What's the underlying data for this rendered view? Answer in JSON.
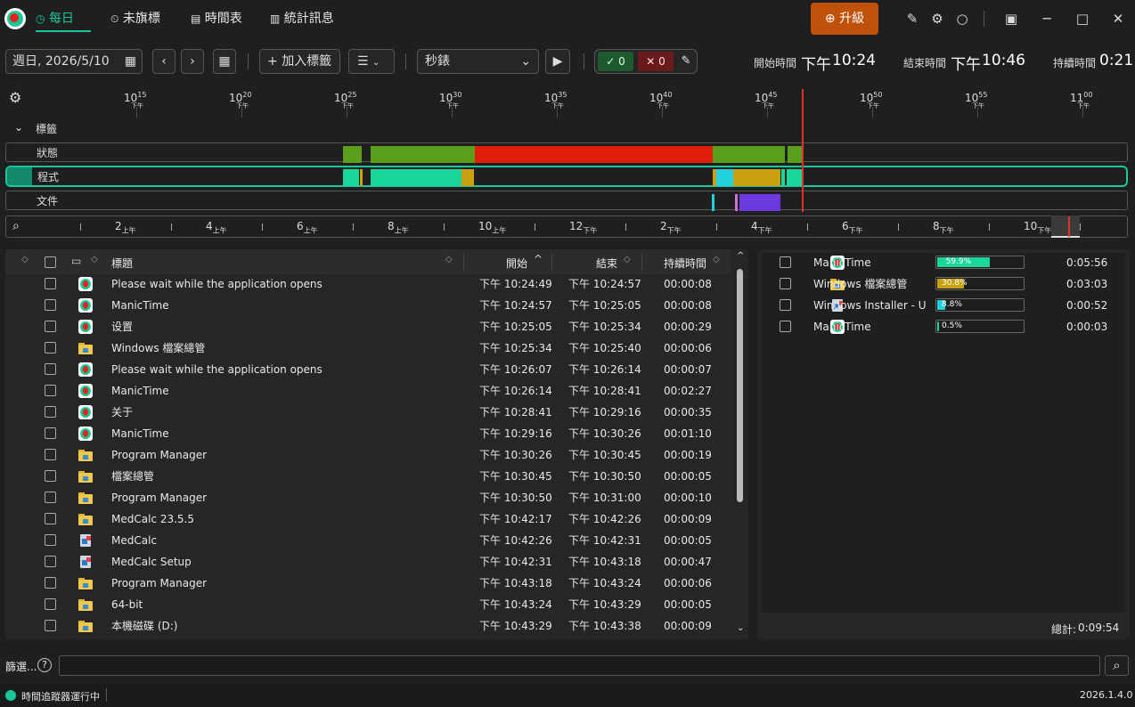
{
  "nav": {
    "tabs": [
      {
        "label": "每日"
      },
      {
        "label": "未旗標"
      },
      {
        "label": "時間表"
      },
      {
        "label": "統計訊息"
      }
    ],
    "upgrade_label": "升級"
  },
  "toolbar": {
    "date": "週日, 2026/5/10",
    "add_tag": "加入標籤",
    "mode": "秒錶",
    "check_count": "0",
    "x_count": "0",
    "start_label": "開始時間",
    "start_ampm": "下午",
    "start_time": "10:24",
    "end_label": "結束時間",
    "end_ampm": "下午",
    "end_time": "10:46",
    "dur_label": "持續時間",
    "dur_value": "0:21"
  },
  "timeline": {
    "ticks": [
      {
        "h": "10",
        "m": "15",
        "ap": "下午"
      },
      {
        "h": "10",
        "m": "20",
        "ap": "下午"
      },
      {
        "h": "10",
        "m": "25",
        "ap": "下午"
      },
      {
        "h": "10",
        "m": "30",
        "ap": "下午"
      },
      {
        "h": "10",
        "m": "35",
        "ap": "下午"
      },
      {
        "h": "10",
        "m": "40",
        "ap": "下午"
      },
      {
        "h": "10",
        "m": "45",
        "ap": "下午"
      },
      {
        "h": "10",
        "m": "50",
        "ap": "下午"
      },
      {
        "h": "10",
        "m": "55",
        "ap": "下午"
      },
      {
        "h": "11",
        "m": "00",
        "ap": "下午"
      }
    ],
    "rows": {
      "tags": "標籤",
      "status": "狀態",
      "apps": "程式",
      "docs": "文件"
    },
    "overview_ticks": [
      {
        "h": "2",
        "ap": "上午"
      },
      {
        "h": "4",
        "ap": "上午"
      },
      {
        "h": "6",
        "ap": "上午"
      },
      {
        "h": "8",
        "ap": "上午"
      },
      {
        "h": "10",
        "ap": "上午"
      },
      {
        "h": "12",
        "ap": "下午"
      },
      {
        "h": "2",
        "ap": "下午"
      },
      {
        "h": "4",
        "ap": "下午"
      },
      {
        "h": "6",
        "ap": "下午"
      },
      {
        "h": "8",
        "ap": "下午"
      },
      {
        "h": "10",
        "ap": "下午"
      }
    ]
  },
  "grid": {
    "headers": {
      "title": "標題",
      "start": "開始",
      "end": "結束",
      "duration": "持續時間"
    },
    "rows": [
      {
        "icon": "manictime",
        "title": "Please wait while the application opens",
        "start": "下午 10:24:49",
        "end": "下午 10:24:57",
        "dur": "00:00:08"
      },
      {
        "icon": "manictime",
        "title": "ManicTime",
        "start": "下午 10:24:57",
        "end": "下午 10:25:05",
        "dur": "00:00:08"
      },
      {
        "icon": "manictime",
        "title": "设置",
        "start": "下午 10:25:05",
        "end": "下午 10:25:34",
        "dur": "00:00:29"
      },
      {
        "icon": "folder",
        "title": "Windows 檔案總管",
        "start": "下午 10:25:34",
        "end": "下午 10:25:40",
        "dur": "00:00:06"
      },
      {
        "icon": "manictime",
        "title": "Please wait while the application opens",
        "start": "下午 10:26:07",
        "end": "下午 10:26:14",
        "dur": "00:00:07"
      },
      {
        "icon": "manictime",
        "title": "ManicTime",
        "start": "下午 10:26:14",
        "end": "下午 10:28:41",
        "dur": "00:02:27"
      },
      {
        "icon": "manictime",
        "title": "关于",
        "start": "下午 10:28:41",
        "end": "下午 10:29:16",
        "dur": "00:00:35"
      },
      {
        "icon": "manictime",
        "title": "ManicTime",
        "start": "下午 10:29:16",
        "end": "下午 10:30:26",
        "dur": "00:01:10"
      },
      {
        "icon": "folder",
        "title": "Program Manager",
        "start": "下午 10:30:26",
        "end": "下午 10:30:45",
        "dur": "00:00:19"
      },
      {
        "icon": "folder",
        "title": "檔案總管",
        "start": "下午 10:30:45",
        "end": "下午 10:30:50",
        "dur": "00:00:05"
      },
      {
        "icon": "folder",
        "title": "Program Manager",
        "start": "下午 10:30:50",
        "end": "下午 10:31:00",
        "dur": "00:00:10"
      },
      {
        "icon": "folder",
        "title": "MedCalc 23.5.5",
        "start": "下午 10:42:17",
        "end": "下午 10:42:26",
        "dur": "00:00:09"
      },
      {
        "icon": "installer",
        "title": "MedCalc",
        "start": "下午 10:42:26",
        "end": "下午 10:42:31",
        "dur": "00:00:05"
      },
      {
        "icon": "installer",
        "title": "MedCalc Setup",
        "start": "下午 10:42:31",
        "end": "下午 10:43:18",
        "dur": "00:00:47"
      },
      {
        "icon": "folder",
        "title": "Program Manager",
        "start": "下午 10:43:18",
        "end": "下午 10:43:24",
        "dur": "00:00:06"
      },
      {
        "icon": "folder",
        "title": "64-bit",
        "start": "下午 10:43:24",
        "end": "下午 10:43:29",
        "dur": "00:00:05"
      },
      {
        "icon": "folder",
        "title": "本機磁碟 (D:)",
        "start": "下午 10:43:29",
        "end": "下午 10:43:38",
        "dur": "00:00:09"
      }
    ]
  },
  "summary": {
    "rows": [
      {
        "icon": "manictime",
        "name": "ManicTime",
        "pct": 59.9,
        "pct_label": "59.9%",
        "color": "#19d69b",
        "time": "0:05:56"
      },
      {
        "icon": "folder",
        "name": "Windows 檔案總管",
        "pct": 30.8,
        "pct_label": "30.8%",
        "color": "#c8a010",
        "time": "0:03:03"
      },
      {
        "icon": "installer",
        "name": "Windows Installer - Un",
        "pct": 8.8,
        "pct_label": "8.8%",
        "color": "#22d0e0",
        "time": "0:00:52"
      },
      {
        "icon": "manictime",
        "name": "ManicTime",
        "pct": 0.5,
        "pct_label": "0.5%",
        "color": "#19d69b",
        "time": "0:00:03"
      }
    ],
    "total_label": "總計:",
    "total": "0:09:54"
  },
  "filter": {
    "label": "篩選..."
  },
  "status": {
    "text": "時間追蹤器運行中",
    "version": "2026.1.4.0"
  },
  "colors": {
    "accent": "#19c79b",
    "upgrade": "#c0510a",
    "active": "#5a9e1e",
    "away": "#e01c0a",
    "now": "#e0302a"
  }
}
